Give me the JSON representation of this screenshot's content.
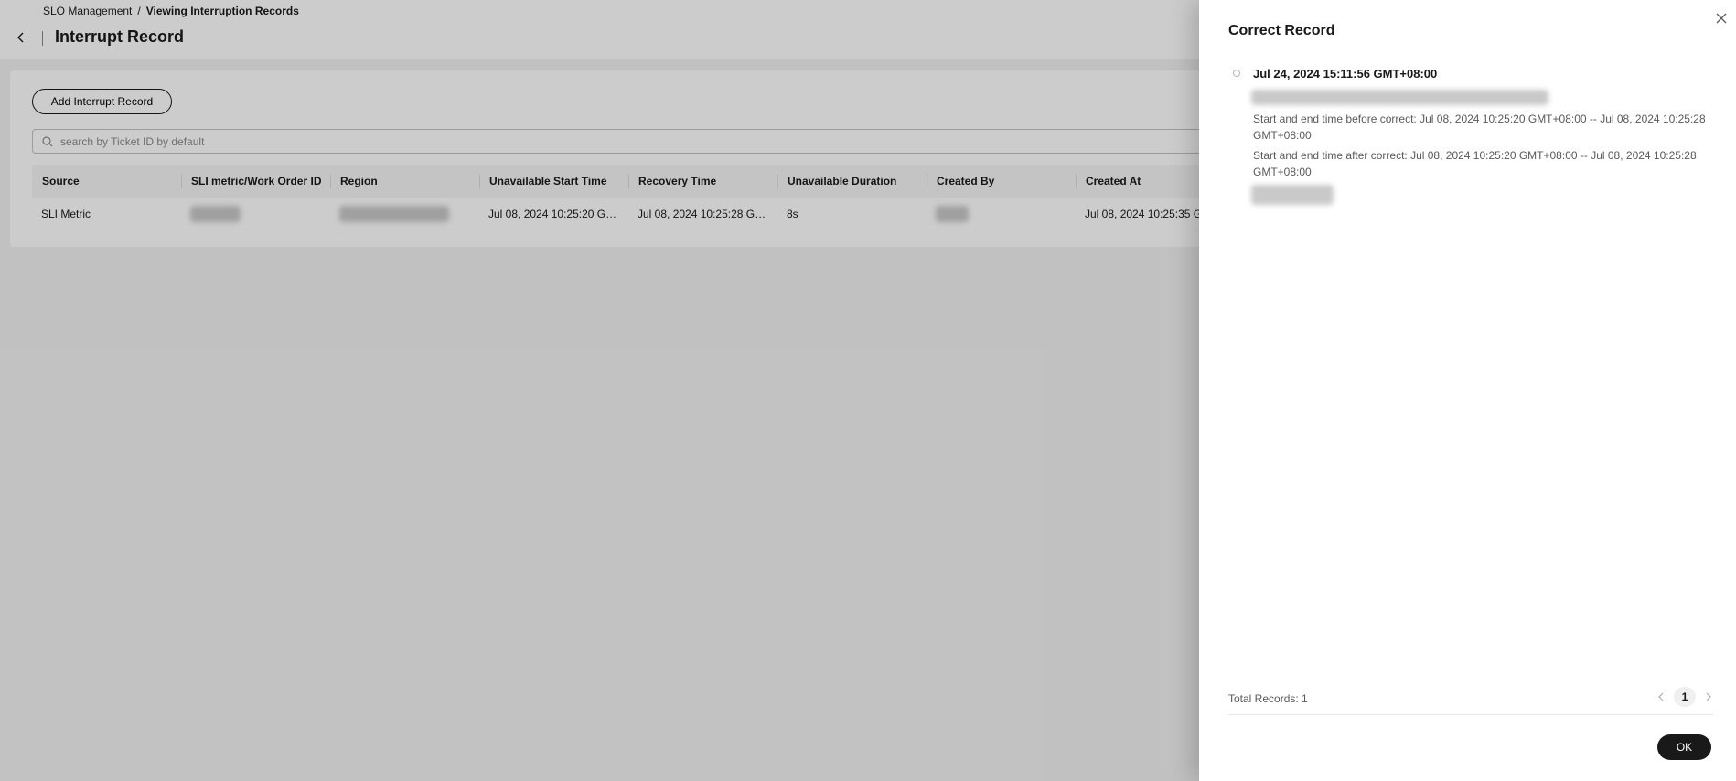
{
  "breadcrumb": {
    "parent": "SLO Management",
    "separator": "/",
    "current": "Viewing Interruption Records"
  },
  "page": {
    "title": "Interrupt Record",
    "add_button": "Add Interrupt Record",
    "search_placeholder": "search by Ticket ID by default"
  },
  "table": {
    "columns": [
      "Source",
      "SLI metric/Work Order ID",
      "Region",
      "Unavailable Start Time",
      "Recovery Time",
      "Unavailable Duration",
      "Created By",
      "Created At"
    ],
    "rows": [
      {
        "source": "SLI Metric",
        "sli_work_order_id": "",
        "region": "",
        "unavailable_start": "Jul 08, 2024 10:25:20 GMT+08:00",
        "recovery": "Jul 08, 2024 10:25:28 GMT+08:00",
        "duration": "8s",
        "created_by": "",
        "created_at": "Jul 08, 2024 10:25:35 G"
      }
    ]
  },
  "drawer": {
    "title": "Correct Record",
    "record": {
      "time": "Jul 24, 2024 15:11:56 GMT+08:00",
      "before": "Start and end time before correct: Jul 08, 2024 10:25:20 GMT+08:00 -- Jul 08, 2024 10:25:28 GMT+08:00",
      "after": "Start and end time after correct: Jul 08, 2024 10:25:20 GMT+08:00 -- Jul 08, 2024 10:25:28 GMT+08:00"
    },
    "total": "Total Records: 1",
    "current_page": "1",
    "ok_label": "OK"
  },
  "icons": {
    "back": "chevron-left-icon",
    "search": "search-icon",
    "close": "close-icon",
    "prev": "chevron-left-icon",
    "next": "chevron-right-icon"
  }
}
